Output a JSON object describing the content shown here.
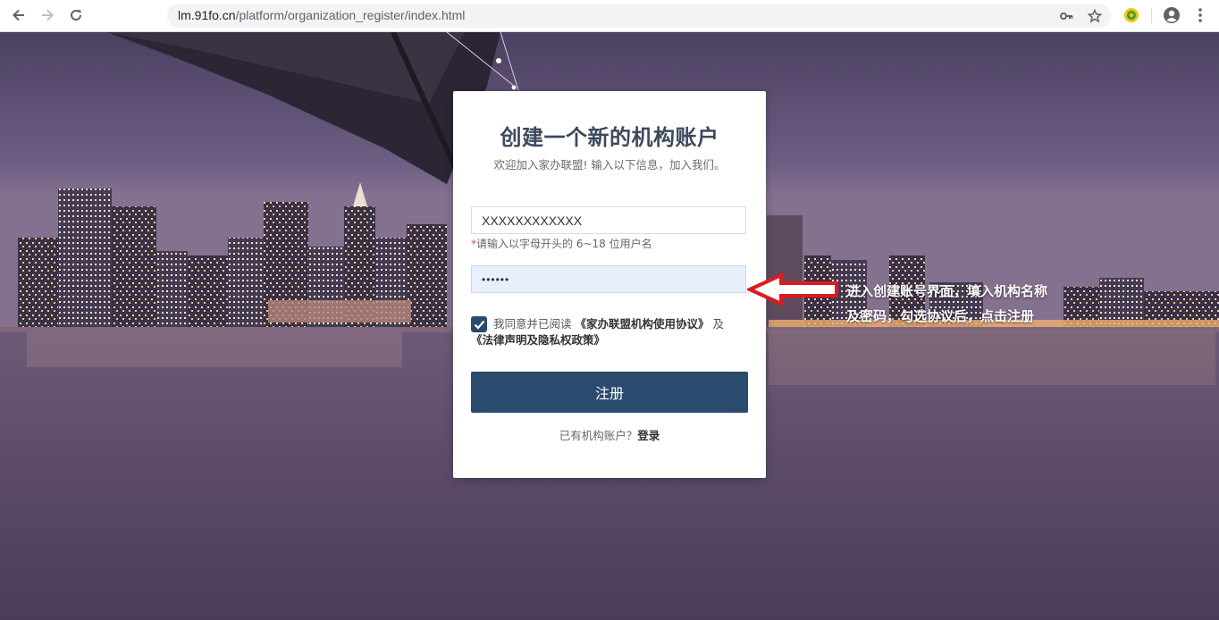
{
  "browser": {
    "url_host": "lm.91fo.cn",
    "url_path": "/platform/organization_register/index.html"
  },
  "card": {
    "title": "创建一个新的机构账户",
    "subtitle": "欢迎加入家办联盟! 输入以下信息，加入我们。",
    "username_value": "XXXXXXXXXXXX",
    "username_hint_mark": "*",
    "username_hint": "请输入以字母开头的 6~18 位用户名",
    "password_value": "••••••",
    "agree_prefix": "我同意并已阅读",
    "agree_link1": "《家办联盟机构使用协议》",
    "agree_and": "及",
    "agree_link2": "《法律声明及隐私权政策》",
    "agree_checked": true,
    "submit_label": "注册",
    "login_prompt": "已有机构账户？",
    "login_link": "登录"
  },
  "annotation": {
    "line1": "进入创建账号界面，填入机构名称",
    "line2": "及密码，勾选协议后，点击注册"
  },
  "colors": {
    "primary": "#2a4a6e",
    "title": "#3d4a5c",
    "required": "#d9534f",
    "arrow": "#e0191e"
  }
}
